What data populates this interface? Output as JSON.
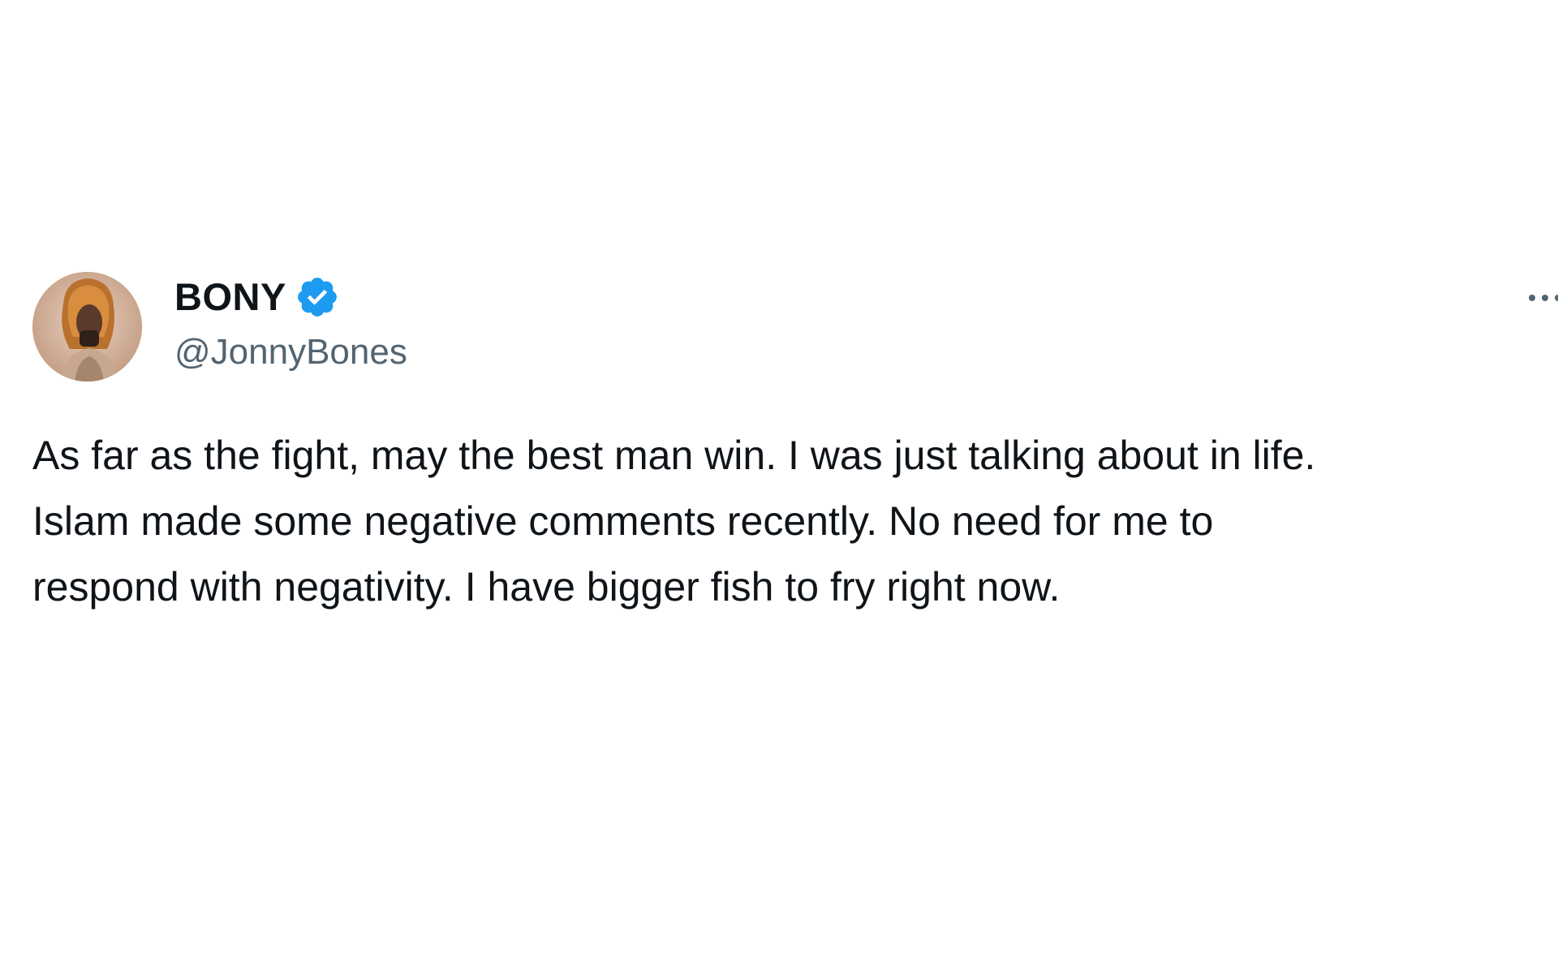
{
  "tweet": {
    "author": {
      "display_name": "BONY",
      "handle": "@JonnyBones",
      "verified": true,
      "verified_color": "#1d9bf0"
    },
    "text": "As far as the fight, may the best man win. I was just talking about in life.\nIslam made some negative comments recently. No need for me to\nrespond with negativity. I have bigger fish to fry right now.",
    "icons": {
      "avatar": "avatar-photo",
      "verified": "verified-badge-icon",
      "more": "more-options-icon"
    }
  },
  "colors": {
    "text_primary": "#0f1419",
    "text_secondary": "#536471",
    "background": "#ffffff"
  }
}
